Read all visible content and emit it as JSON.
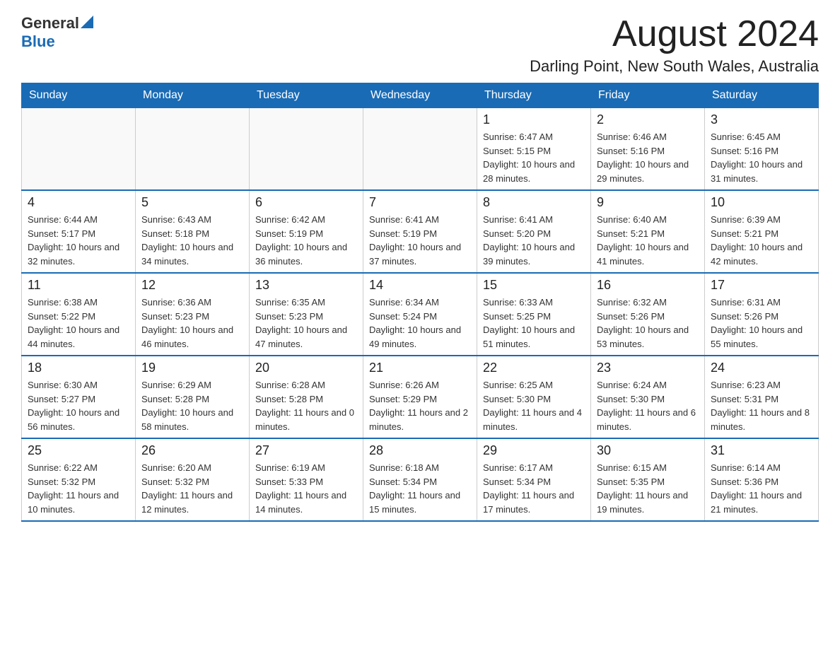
{
  "header": {
    "logo_general": "General",
    "logo_blue": "Blue",
    "month_title": "August 2024",
    "location": "Darling Point, New South Wales, Australia"
  },
  "calendar": {
    "days_of_week": [
      "Sunday",
      "Monday",
      "Tuesday",
      "Wednesday",
      "Thursday",
      "Friday",
      "Saturday"
    ],
    "weeks": [
      [
        {
          "day": "",
          "info": ""
        },
        {
          "day": "",
          "info": ""
        },
        {
          "day": "",
          "info": ""
        },
        {
          "day": "",
          "info": ""
        },
        {
          "day": "1",
          "info": "Sunrise: 6:47 AM\nSunset: 5:15 PM\nDaylight: 10 hours and 28 minutes."
        },
        {
          "day": "2",
          "info": "Sunrise: 6:46 AM\nSunset: 5:16 PM\nDaylight: 10 hours and 29 minutes."
        },
        {
          "day": "3",
          "info": "Sunrise: 6:45 AM\nSunset: 5:16 PM\nDaylight: 10 hours and 31 minutes."
        }
      ],
      [
        {
          "day": "4",
          "info": "Sunrise: 6:44 AM\nSunset: 5:17 PM\nDaylight: 10 hours and 32 minutes."
        },
        {
          "day": "5",
          "info": "Sunrise: 6:43 AM\nSunset: 5:18 PM\nDaylight: 10 hours and 34 minutes."
        },
        {
          "day": "6",
          "info": "Sunrise: 6:42 AM\nSunset: 5:19 PM\nDaylight: 10 hours and 36 minutes."
        },
        {
          "day": "7",
          "info": "Sunrise: 6:41 AM\nSunset: 5:19 PM\nDaylight: 10 hours and 37 minutes."
        },
        {
          "day": "8",
          "info": "Sunrise: 6:41 AM\nSunset: 5:20 PM\nDaylight: 10 hours and 39 minutes."
        },
        {
          "day": "9",
          "info": "Sunrise: 6:40 AM\nSunset: 5:21 PM\nDaylight: 10 hours and 41 minutes."
        },
        {
          "day": "10",
          "info": "Sunrise: 6:39 AM\nSunset: 5:21 PM\nDaylight: 10 hours and 42 minutes."
        }
      ],
      [
        {
          "day": "11",
          "info": "Sunrise: 6:38 AM\nSunset: 5:22 PM\nDaylight: 10 hours and 44 minutes."
        },
        {
          "day": "12",
          "info": "Sunrise: 6:36 AM\nSunset: 5:23 PM\nDaylight: 10 hours and 46 minutes."
        },
        {
          "day": "13",
          "info": "Sunrise: 6:35 AM\nSunset: 5:23 PM\nDaylight: 10 hours and 47 minutes."
        },
        {
          "day": "14",
          "info": "Sunrise: 6:34 AM\nSunset: 5:24 PM\nDaylight: 10 hours and 49 minutes."
        },
        {
          "day": "15",
          "info": "Sunrise: 6:33 AM\nSunset: 5:25 PM\nDaylight: 10 hours and 51 minutes."
        },
        {
          "day": "16",
          "info": "Sunrise: 6:32 AM\nSunset: 5:26 PM\nDaylight: 10 hours and 53 minutes."
        },
        {
          "day": "17",
          "info": "Sunrise: 6:31 AM\nSunset: 5:26 PM\nDaylight: 10 hours and 55 minutes."
        }
      ],
      [
        {
          "day": "18",
          "info": "Sunrise: 6:30 AM\nSunset: 5:27 PM\nDaylight: 10 hours and 56 minutes."
        },
        {
          "day": "19",
          "info": "Sunrise: 6:29 AM\nSunset: 5:28 PM\nDaylight: 10 hours and 58 minutes."
        },
        {
          "day": "20",
          "info": "Sunrise: 6:28 AM\nSunset: 5:28 PM\nDaylight: 11 hours and 0 minutes."
        },
        {
          "day": "21",
          "info": "Sunrise: 6:26 AM\nSunset: 5:29 PM\nDaylight: 11 hours and 2 minutes."
        },
        {
          "day": "22",
          "info": "Sunrise: 6:25 AM\nSunset: 5:30 PM\nDaylight: 11 hours and 4 minutes."
        },
        {
          "day": "23",
          "info": "Sunrise: 6:24 AM\nSunset: 5:30 PM\nDaylight: 11 hours and 6 minutes."
        },
        {
          "day": "24",
          "info": "Sunrise: 6:23 AM\nSunset: 5:31 PM\nDaylight: 11 hours and 8 minutes."
        }
      ],
      [
        {
          "day": "25",
          "info": "Sunrise: 6:22 AM\nSunset: 5:32 PM\nDaylight: 11 hours and 10 minutes."
        },
        {
          "day": "26",
          "info": "Sunrise: 6:20 AM\nSunset: 5:32 PM\nDaylight: 11 hours and 12 minutes."
        },
        {
          "day": "27",
          "info": "Sunrise: 6:19 AM\nSunset: 5:33 PM\nDaylight: 11 hours and 14 minutes."
        },
        {
          "day": "28",
          "info": "Sunrise: 6:18 AM\nSunset: 5:34 PM\nDaylight: 11 hours and 15 minutes."
        },
        {
          "day": "29",
          "info": "Sunrise: 6:17 AM\nSunset: 5:34 PM\nDaylight: 11 hours and 17 minutes."
        },
        {
          "day": "30",
          "info": "Sunrise: 6:15 AM\nSunset: 5:35 PM\nDaylight: 11 hours and 19 minutes."
        },
        {
          "day": "31",
          "info": "Sunrise: 6:14 AM\nSunset: 5:36 PM\nDaylight: 11 hours and 21 minutes."
        }
      ]
    ]
  }
}
